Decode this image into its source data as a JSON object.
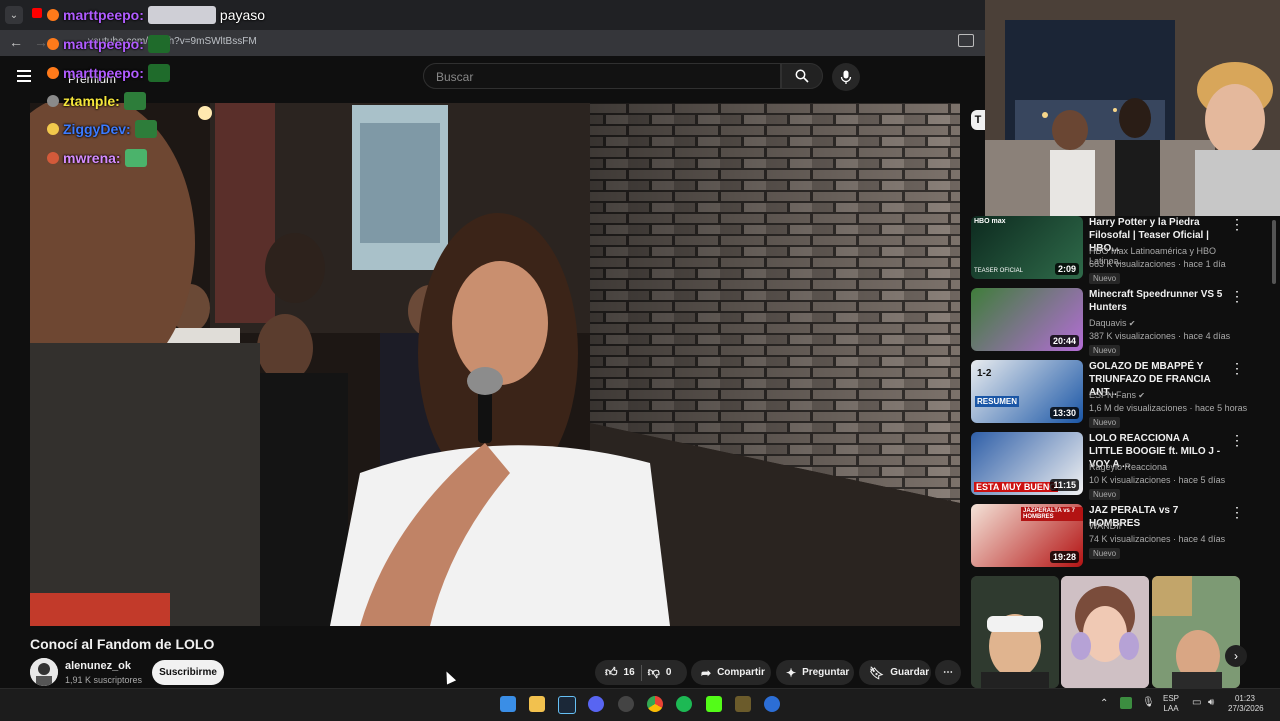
{
  "browser": {
    "url": "youtube.com/watch?v=9mSWltBssFM"
  },
  "youtube": {
    "logo": "Premium",
    "search_placeholder": "Buscar",
    "chip_label": "T"
  },
  "chat": [
    {
      "user": "marttpeepo:",
      "color": "#b05cff",
      "message": "payaso",
      "emote": "",
      "badge_color": "#ff7a1a"
    },
    {
      "user": "marttpeepo:",
      "color": "#b05cff",
      "message": "",
      "emote": "#1f6b2b",
      "badge_color": "#ff7a1a"
    },
    {
      "user": "marttpeepo:",
      "color": "#b05cff",
      "message": "",
      "emote": "#1f6b2b",
      "badge_color": "#ff7a1a"
    },
    {
      "user": "ztample:",
      "color": "#f5e63b",
      "message": "",
      "emote": "#2d7d3a",
      "badge_color": "#8a8a8a"
    },
    {
      "user": "ZiggyDev:",
      "color": "#3d7bff",
      "message": "",
      "emote": "#2d7d3a",
      "badge_color": "#f2c94c"
    },
    {
      "user": "mwrena:",
      "color": "#d58cff",
      "message": "",
      "emote": "#4bb36b",
      "badge_color": "#d35a3a"
    }
  ],
  "video": {
    "title": "Conocí al Fandom de LOLO",
    "channel": "alenunez_ok",
    "subscribers": "1,91 K suscriptores",
    "subscribe_label": "Suscribirme",
    "likes": "16",
    "dislikes": "0",
    "share_label": "Compartir",
    "ask_label": "Preguntar",
    "save_label": "Guardar"
  },
  "recommendations": [
    {
      "title": "Harry Potter y la Piedra Filosofal | Teaser Oficial | HBO...",
      "channel": "HBO Max Latinoamérica y HBO Latinoa...",
      "meta": "663 K visualizaciones · hace 1 día",
      "duration": "2:09",
      "badge": "Nuevo",
      "verified": false
    },
    {
      "title": "Minecraft Speedrunner VS 5 Hunters",
      "channel": "Daquavis",
      "meta": "387 K visualizaciones · hace 4 días",
      "duration": "20:44",
      "badge": "Nuevo",
      "verified": true
    },
    {
      "title": "GOLAZO DE MBAPPÉ Y TRIUNFAZO DE FRANCIA ANT...",
      "channel": "ESPN Fans",
      "meta": "1,6 M de visualizaciones · hace 5 horas",
      "duration": "13:30",
      "badge": "Nuevo",
      "verified": true
    },
    {
      "title": "LOLO REACCIONA A LITTLE BOOGIE ft. MILO J - VOY A ...",
      "channel": "Rageylo Reacciona",
      "meta": "10 K visualizaciones · hace 5 días",
      "duration": "11:15",
      "badge": "Nuevo",
      "verified": false
    },
    {
      "title": "JAZ PERALTA vs 7 HOMBRES",
      "channel": "WANDII",
      "meta": "74 K visualizaciones · hace 4 días",
      "duration": "19:28",
      "badge": "Nuevo",
      "verified": false
    }
  ],
  "thumb_texts": {
    "hbo": "HBO max",
    "hbo_sub": "TEASER OFICIAL",
    "espn": "RESUMEN",
    "score": "1-2",
    "lolo": "ESTA MUY BUENO",
    "jaz": "JAZPERALTA vs 7 HOMBRES"
  },
  "taskbar": {
    "lang1": "ESP",
    "lang2": "LAA",
    "time": "01:23",
    "date": "27/3/2026"
  },
  "colors": {
    "youtube_bg": "#0f0f0f",
    "taskbar_bg": "#1c1c1c",
    "chrome_tab": "#202124"
  }
}
